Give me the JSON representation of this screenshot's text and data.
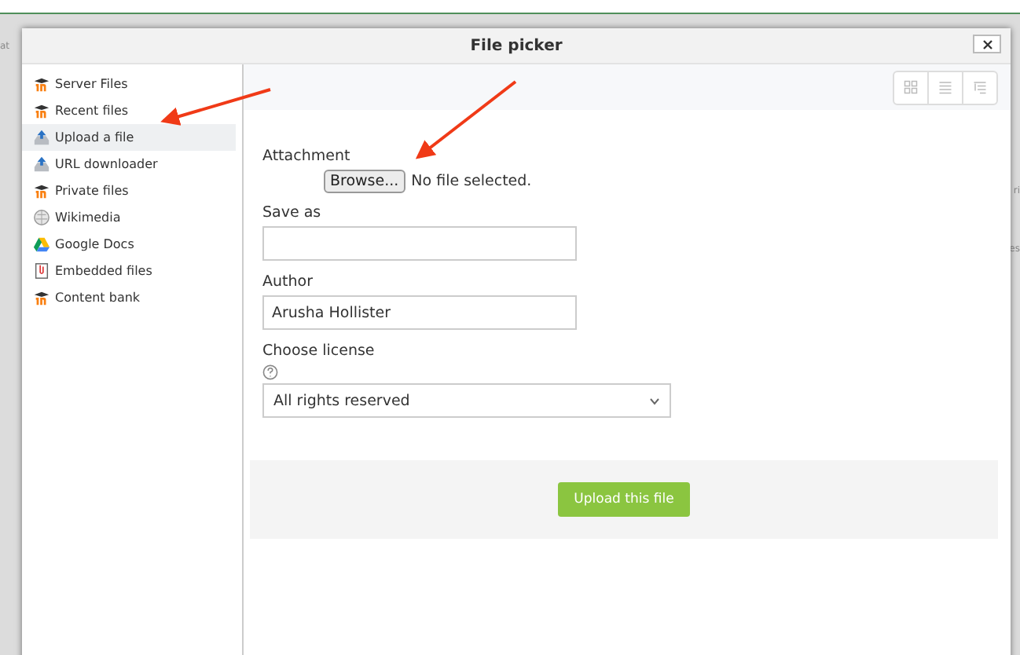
{
  "background": {
    "left_fragment": "at",
    "right_fragments": [
      "ri",
      "es"
    ]
  },
  "dialog": {
    "title": "File picker",
    "sidebar": {
      "items": [
        {
          "label": "Server Files",
          "kind": "moodle",
          "selected": false
        },
        {
          "label": "Recent files",
          "kind": "moodle",
          "selected": false
        },
        {
          "label": "Upload a file",
          "kind": "upload",
          "selected": true
        },
        {
          "label": "URL downloader",
          "kind": "upload",
          "selected": false
        },
        {
          "label": "Private files",
          "kind": "moodle",
          "selected": false
        },
        {
          "label": "Wikimedia",
          "kind": "globe",
          "selected": false
        },
        {
          "label": "Google Docs",
          "kind": "drive",
          "selected": false
        },
        {
          "label": "Embedded files",
          "kind": "clip",
          "selected": false
        },
        {
          "label": "Content bank",
          "kind": "moodle",
          "selected": false
        }
      ]
    },
    "view_buttons": [
      {
        "kind": "icons"
      },
      {
        "kind": "list"
      },
      {
        "kind": "tree"
      }
    ],
    "form": {
      "attachment": {
        "label": "Attachment",
        "button": "Browse...",
        "status": "No file selected."
      },
      "save_as": {
        "label": "Save as"
      },
      "author": {
        "label": "Author",
        "value": "Arusha Hollister"
      },
      "license": {
        "label": "Choose license",
        "value": "All rights reserved"
      }
    },
    "upload_button": "Upload this file"
  }
}
